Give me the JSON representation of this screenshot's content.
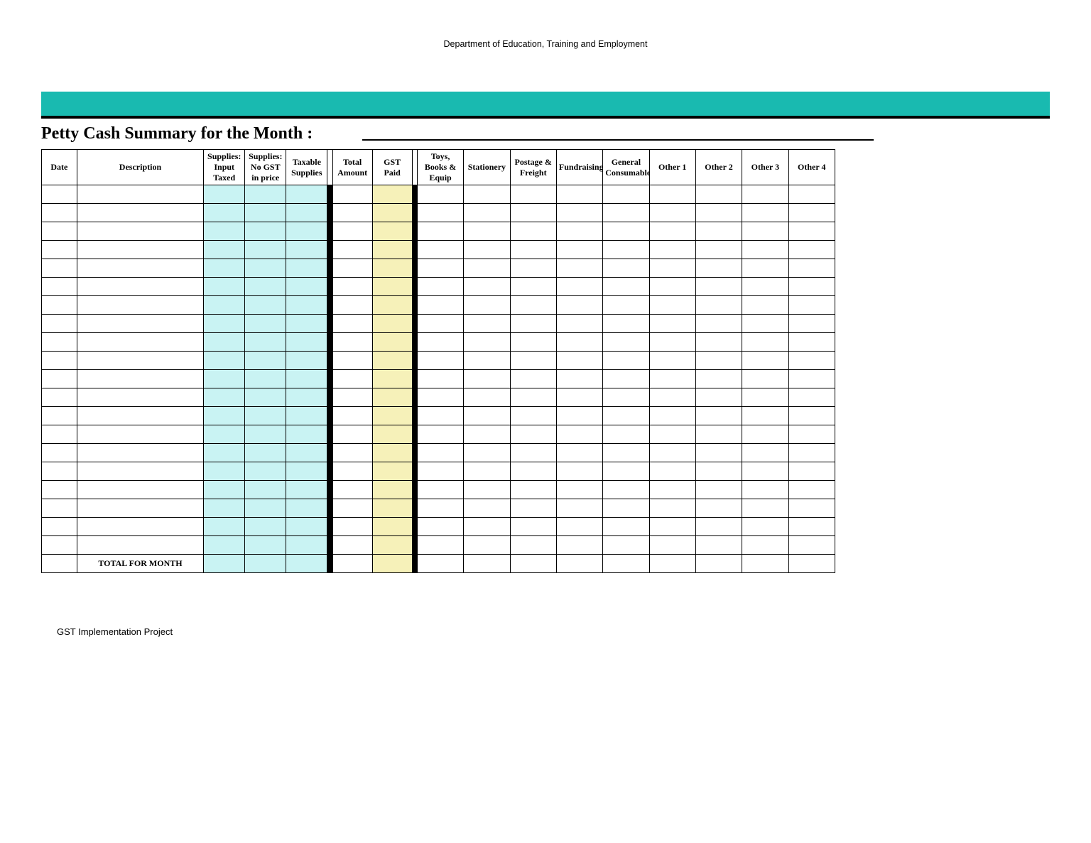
{
  "header": {
    "department": "Department of Education, Training and Employment"
  },
  "title": "Petty Cash Summary for the Month :",
  "columns": {
    "date": "Date",
    "description": "Description",
    "supplies_input_taxed": "Supplies: Input Taxed",
    "supplies_no_gst": "Supplies: No GST in price",
    "taxable_supplies": "Taxable Supplies",
    "total_amount": "Total Amount",
    "gst_paid": "GST Paid",
    "toys_books_equip": "Toys, Books & Equip",
    "stationery": "Stationery",
    "postage_freight": "Postage & Freight",
    "fundraising": "Fundraising",
    "general_consumables": "General Consumables",
    "other1": "Other 1",
    "other2": "Other 2",
    "other3": "Other 3",
    "other4": "Other 4"
  },
  "row_count": 20,
  "total_row_label": "TOTAL FOR MONTH",
  "footer": "GST Implementation Project"
}
